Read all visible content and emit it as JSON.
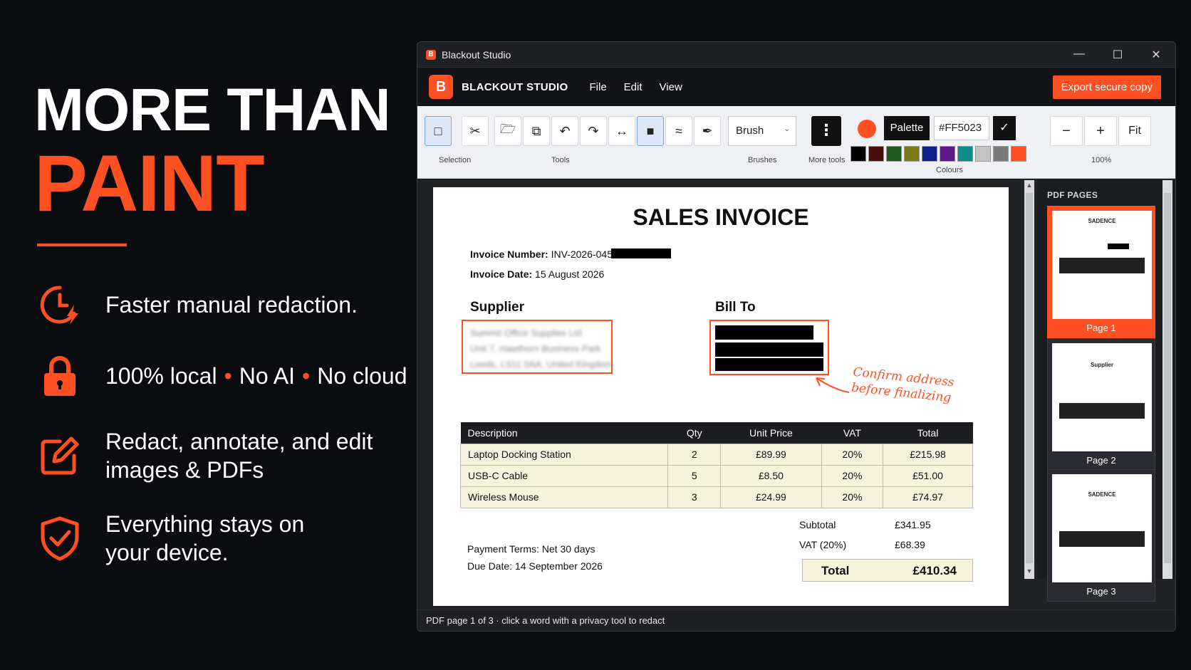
{
  "hero": {
    "line1": "MORE THAN",
    "line2": "PAINT"
  },
  "features": [
    {
      "icon": "clock-bolt-icon",
      "text": "Faster manual redaction."
    },
    {
      "icon": "lock-icon",
      "parts": [
        "100% local",
        "No AI",
        "No cloud"
      ]
    },
    {
      "icon": "edit-icon",
      "line1": "Redact, annotate, and edit",
      "line2": "images & PDFs"
    },
    {
      "icon": "shield-check-icon",
      "line1": "Everything stays on",
      "line2": "your device."
    }
  ],
  "colors": {
    "accent": "#FF5023",
    "background": "#0A0C10"
  },
  "window": {
    "title": "Blackout Studio",
    "brand": {
      "logo": "B",
      "name": "BLACKOUT STUDIO"
    },
    "menu": [
      "File",
      "Edit",
      "View"
    ],
    "export_label": "Export secure copy"
  },
  "ribbon": {
    "groups": {
      "selection": "Selection",
      "tools": "Tools",
      "brushes": "Brushes",
      "more_tools": "More tools",
      "colours": "Colours",
      "zoom": "100%"
    },
    "brush_value": "Brush",
    "palette_label": "Palette",
    "hex_value": "#FF5023",
    "zoom_fit": "Fit",
    "swatches": [
      "#000000",
      "#4a0d0d",
      "#1f5a1f",
      "#7a7a18",
      "#10208a",
      "#5a1a8a",
      "#108a8a",
      "#c4c4c4",
      "#7a7a7a",
      "#ff5023"
    ]
  },
  "invoice": {
    "title": "SALES INVOICE",
    "number_label": "Invoice Number:",
    "number_value": "INV-2026-0457",
    "date_label": "Invoice Date:",
    "date_value": "15 August 2026",
    "supplier_head": "Supplier",
    "billto_head": "Bill To",
    "supplier_lines": [
      "Summit Office Supplies Ltd",
      "Unit 7, Hawthorn Business Park",
      "Leeds, LS11 0AA, United Kingdom"
    ],
    "note_line1": "Confirm address",
    "note_line2": "before finalizing",
    "columns": [
      "Description",
      "Qty",
      "Unit Price",
      "VAT",
      "Total"
    ],
    "rows": [
      [
        "Laptop Docking Station",
        "2",
        "£89.99",
        "20%",
        "£215.98"
      ],
      [
        "USB-C Cable",
        "5",
        "£8.50",
        "20%",
        "£51.00"
      ],
      [
        "Wireless Mouse",
        "3",
        "£24.99",
        "20%",
        "£74.97"
      ]
    ],
    "subtotal_label": "Subtotal",
    "subtotal_value": "£341.95",
    "vat_label": "VAT (20%)",
    "vat_value": "£68.39",
    "total_label": "Total",
    "total_value": "£410.34",
    "payment_terms": "Payment Terms: Net 30 days",
    "due_date": "Due Date: 14 September 2026"
  },
  "thumbs": {
    "header": "PDF PAGES",
    "pages": [
      "Page 1",
      "Page 2",
      "Page 3"
    ],
    "thumb_titles": [
      "SADENCE",
      "Supplier",
      "SADENCE"
    ]
  },
  "status": "PDF page 1 of 3  ·  click a word with a privacy tool to redact"
}
